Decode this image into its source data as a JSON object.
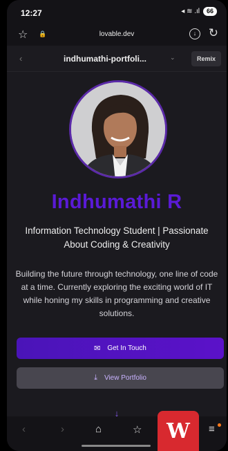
{
  "status": {
    "time": "12:27",
    "signal": "◂ ≋ .ıl",
    "battery": "66"
  },
  "browser": {
    "url": "lovable.dev"
  },
  "app": {
    "project_name": "indhumathi-portfoli...",
    "remix_label": "Remix"
  },
  "profile": {
    "name": "Indhumathi R",
    "subtitle": "Information Technology Student | Passionate About Coding & Creativity",
    "bio": "Building the future through technology, one line of code at a time. Currently exploring the exciting world of IT while honing my skills in programming and creative solutions."
  },
  "actions": {
    "contact_label": "Get In Touch",
    "portfolio_label": "View Portfolio"
  },
  "icons": {
    "star": "☆",
    "lock": "🔒",
    "download": "↓",
    "reload": "↻",
    "back": "‹",
    "chevron": "⌄",
    "mail": "✉",
    "portfolio": "⤓",
    "scroll_down": "↓",
    "nav_back": "‹",
    "nav_forward": "›",
    "nav_home": "⌂",
    "nav_bookmark": "☆",
    "nav_menu": "≡",
    "wps": "W"
  },
  "colors": {
    "accent": "#5a1ad6",
    "button_primary": "#4a14b8",
    "wps_red": "#d8292f"
  }
}
